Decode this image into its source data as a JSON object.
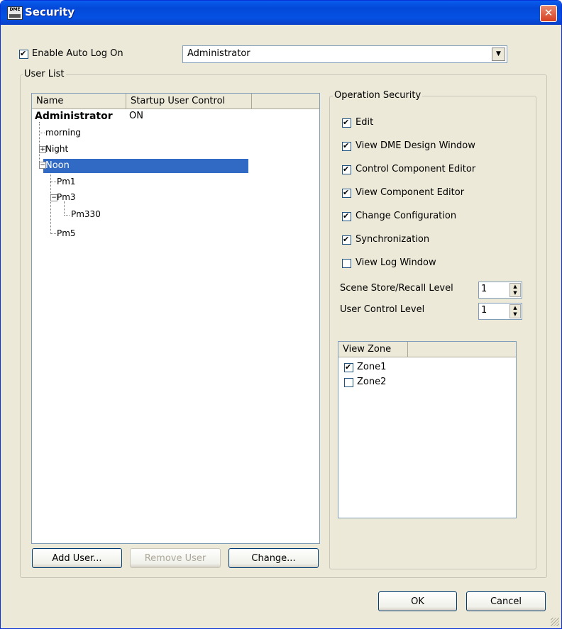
{
  "window": {
    "title": "Security",
    "icon_text": "DME",
    "close_glyph": "✕"
  },
  "auto_logon": {
    "label": "Enable Auto Log On",
    "checked": true,
    "selected_user": "Administrator",
    "dropdown_glyph": "▼"
  },
  "user_list": {
    "group_label": "User List",
    "columns": [
      "Name",
      "Startup User Control"
    ],
    "users": [
      {
        "name": "Administrator",
        "startup": "ON"
      },
      {
        "name": "morning"
      },
      {
        "name": "Night",
        "expander": "+"
      },
      {
        "name": "Noon",
        "expander": "−",
        "selected": true
      },
      {
        "name": "Pm1"
      },
      {
        "name": "Pm3",
        "expander": "−"
      },
      {
        "name": "Pm330"
      },
      {
        "name": "Pm5"
      }
    ],
    "buttons": {
      "add": "Add User...",
      "remove": "Remove User",
      "change": "Change..."
    }
  },
  "operation_security": {
    "group_label": "Operation Security",
    "items": [
      {
        "label": "Edit",
        "checked": true
      },
      {
        "label": "View DME Design Window",
        "checked": true
      },
      {
        "label": "Control Component Editor",
        "checked": true
      },
      {
        "label": "View Component Editor",
        "checked": true
      },
      {
        "label": "Change Configuration",
        "checked": true
      },
      {
        "label": "Synchronization",
        "checked": true
      },
      {
        "label": "View Log Window",
        "checked": false
      }
    ],
    "scene_level": {
      "label": "Scene Store/Recall Level",
      "value": "1"
    },
    "user_control_level": {
      "label": "User Control Level",
      "value": "1"
    },
    "spin_glyphs": {
      "up": "▲",
      "down": "▼"
    },
    "view_zone": {
      "header": "View Zone",
      "zones": [
        {
          "label": "Zone1",
          "checked": true
        },
        {
          "label": "Zone2",
          "checked": false
        }
      ]
    }
  },
  "dialog_buttons": {
    "ok": "OK",
    "cancel": "Cancel"
  },
  "colors": {
    "title_bar": "#0a5eee",
    "selection": "#316ac5",
    "dialog_bg": "#ece9d8"
  }
}
